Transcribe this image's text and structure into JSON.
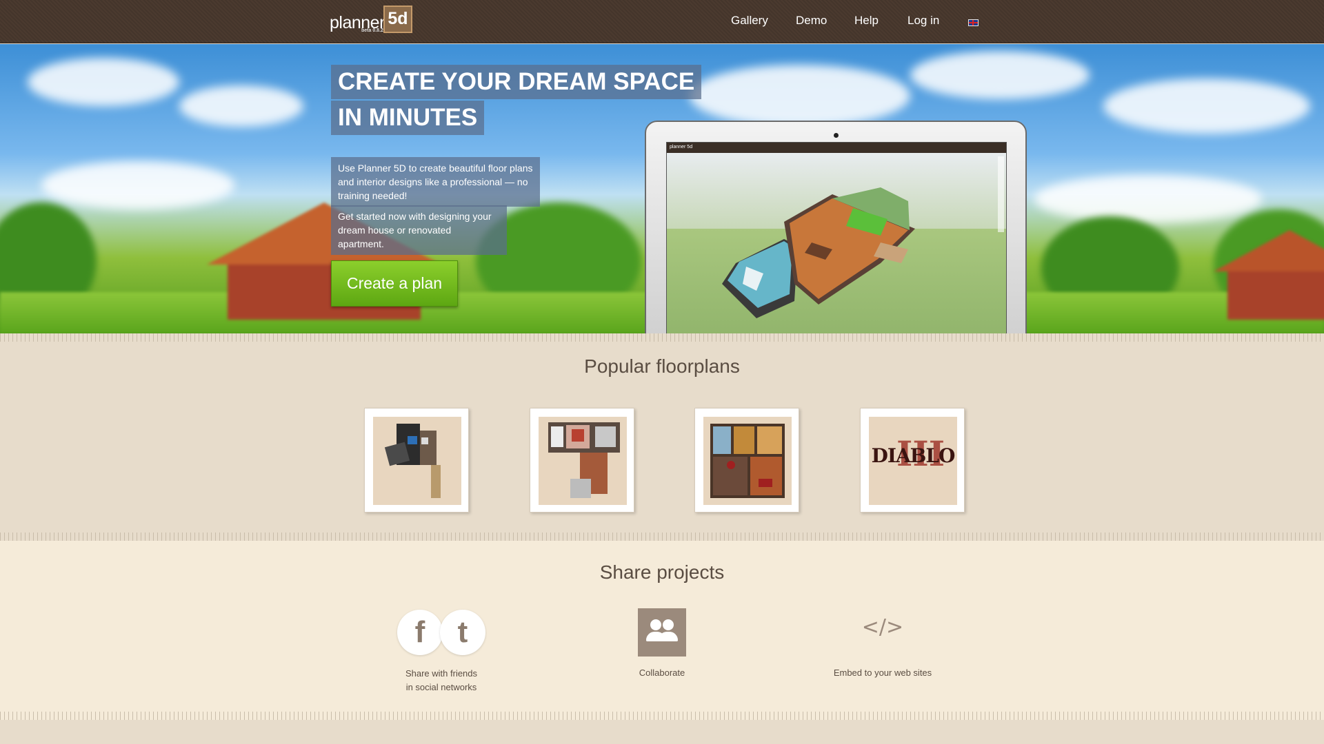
{
  "header": {
    "logo_text": "planner",
    "logo_badge": "5d",
    "logo_version": "beta 0.8.2",
    "nav": [
      "Gallery",
      "Demo",
      "Help",
      "Log in"
    ],
    "language_flag": "uk-flag-icon"
  },
  "hero": {
    "headline_line1": "CREATE YOUR DREAM SPACE",
    "headline_line2": "IN MINUTES",
    "description_1": "Use Planner 5D to create beautiful floor plans and interior designs like a professional — no training needed!",
    "description_2": "Get started now with designing your dream house or renovated apartment.",
    "cta_label": "Create a plan",
    "screen_logo": "planner 5d",
    "colors": {
      "cta": "#6fbb1e",
      "header": "#4b3a2f"
    }
  },
  "popular": {
    "title": "Popular floorplans",
    "cards": [
      {
        "icon": "floorplan-thumbnail"
      },
      {
        "icon": "floorplan-thumbnail"
      },
      {
        "icon": "floorplan-thumbnail"
      },
      {
        "text": "DIABLO",
        "overlay": "III"
      }
    ]
  },
  "share": {
    "title": "Share projects",
    "items": [
      {
        "label_line1": "Share with friends",
        "label_line2": "in social networks",
        "icons": [
          "facebook-icon",
          "twitter-icon"
        ],
        "glyphs": [
          "f",
          "t"
        ]
      },
      {
        "label": "Collaborate",
        "icon": "collaborate-icon"
      },
      {
        "label": "Embed to your web sites",
        "icon": "embed-code-icon",
        "glyph": "</>"
      }
    ]
  }
}
